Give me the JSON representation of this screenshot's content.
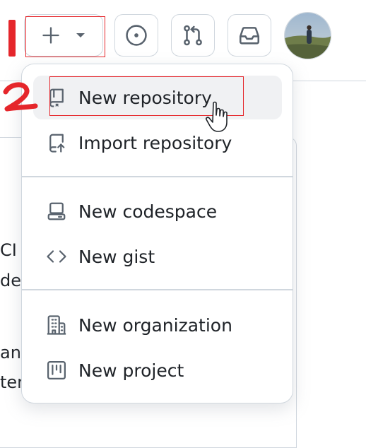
{
  "header": {
    "create_button": {
      "plus_icon": "plus-icon",
      "dropdown_icon": "triangle-down-icon"
    },
    "issues_icon": "issue-opened-icon",
    "pulls_icon": "git-pull-request-icon",
    "inbox_icon": "inbox-icon",
    "avatar": "user-avatar"
  },
  "background_fragments": [
    "CI",
    "de",
    "anc",
    "ter"
  ],
  "menu": {
    "items": [
      {
        "label": "New repository",
        "icon": "repo-icon"
      },
      {
        "label": "Import repository",
        "icon": "repo-push-icon"
      },
      {
        "label": "New codespace",
        "icon": "codespaces-icon"
      },
      {
        "label": "New gist",
        "icon": "code-icon"
      },
      {
        "label": "New organization",
        "icon": "organization-icon"
      },
      {
        "label": "New project",
        "icon": "project-icon"
      }
    ]
  },
  "annotations": {
    "step1": "1",
    "step2": "2"
  },
  "colors": {
    "annotation": "#e5262b",
    "border": "#d0d7de",
    "icon": "#59636e",
    "active_bg": "#f0f1f3"
  }
}
